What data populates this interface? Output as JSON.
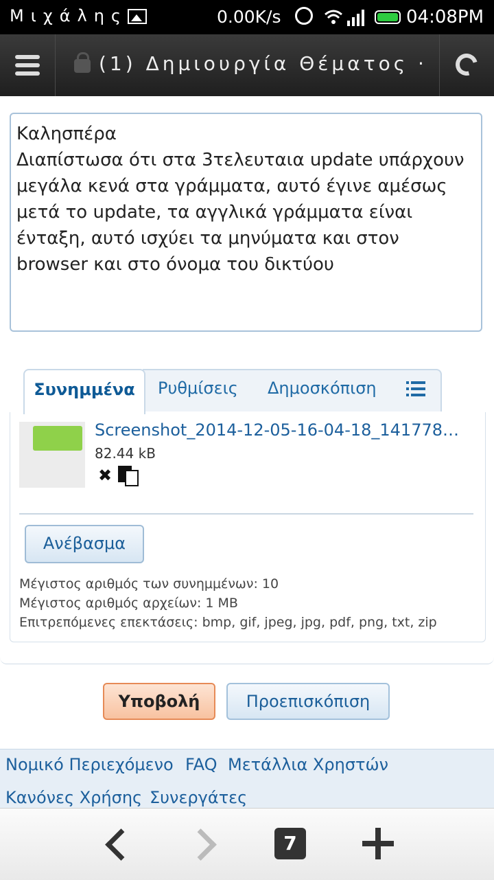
{
  "status_bar": {
    "owner": "Μιχάλης",
    "net_speed": "0.00K/s",
    "time": "04:08PM"
  },
  "app_bar": {
    "title": "(1) Δημιουργία Θέματος ·"
  },
  "editor": {
    "text": "Καλησπέρα\nΔιαπίστωσα ότι στα 3τελευταια update υπάρχουν μεγάλα κενά στα γράμματα, αυτό έγινε αμέσως μετά το update, τα αγγλικά γράμματα είναι ένταξη, αυτό ισχύει τα μηνύματα και στον browser και στο όνομα του δικτύου"
  },
  "tabs": {
    "attachments": "Συνημμένα",
    "settings": "Ρυθμίσεις",
    "poll": "Δημοσκόπιση"
  },
  "attachment": {
    "file_name": "Screenshot_2014-12-05-16-04-18_1417788...",
    "file_size": "82.44 kB"
  },
  "upload": {
    "button_label": "Ανέβασμα",
    "max_attachments": "Μέγιστος αριθμός των συνημμένων: 10",
    "max_files": "Μέγιστος αριθμός αρχείων: 1 MB",
    "allowed_ext": "Επιτρεπόμενες επεκτάσεις: bmp, gif, jpeg, jpg, pdf, png, txt, zip"
  },
  "actions": {
    "submit": "Υποβολή",
    "preview": "Προεπισκόπιση"
  },
  "footer": {
    "legal": "Νομικό Περιεχόμενο",
    "faq": "FAQ",
    "medals": "Μετάλλια Χρηστών",
    "rules": "Κανόνες Χρήσης",
    "partners": "Συνεργάτες"
  },
  "browser_nav": {
    "tab_count": "7"
  },
  "colors": {
    "link": "#1c5f9c",
    "submit_accent": "#f8c2a0",
    "appbar": "#2a2a2a"
  }
}
